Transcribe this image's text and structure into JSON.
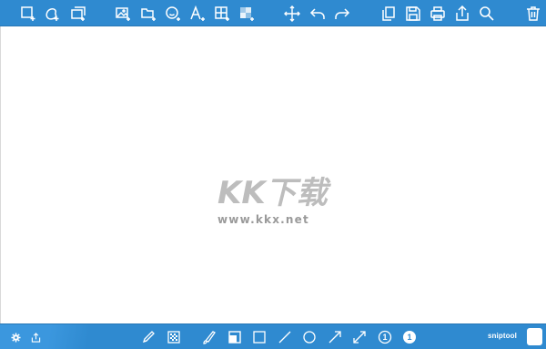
{
  "app": {
    "brand_text": "sniptool"
  },
  "watermark": {
    "logo_text": "KK下载",
    "url_text": "www.kkx.net"
  },
  "colors": {
    "bar": "#2f8ad0",
    "canvas": "#ffffff",
    "icon": "#ffffff",
    "watermark": "#b3b3b3",
    "current_color": "#ffffff"
  },
  "toolbar_top": {
    "icons": [
      "new-capture-icon",
      "capture-freeform-icon",
      "capture-window-icon",
      "insert-image-icon",
      "open-folder-icon",
      "add-emoji-icon",
      "add-text-icon",
      "add-grid-icon",
      "add-pixelate-icon",
      "move-icon",
      "undo-icon",
      "redo-icon",
      "copy-icon",
      "save-icon",
      "print-icon",
      "share-icon",
      "zoom-icon",
      "delete-icon"
    ]
  },
  "toolbar_bottom": {
    "icons": [
      "settings-icon",
      "upload-icon",
      "pencil-icon",
      "blur-icon",
      "brush-icon",
      "fill-rectangle-icon",
      "rectangle-icon",
      "line-icon",
      "ellipse-icon",
      "arrow-icon",
      "double-arrow-icon",
      "number-step-outline-icon",
      "number-step-filled-icon"
    ],
    "number_step_outline": "1",
    "number_step_filled": "1"
  }
}
